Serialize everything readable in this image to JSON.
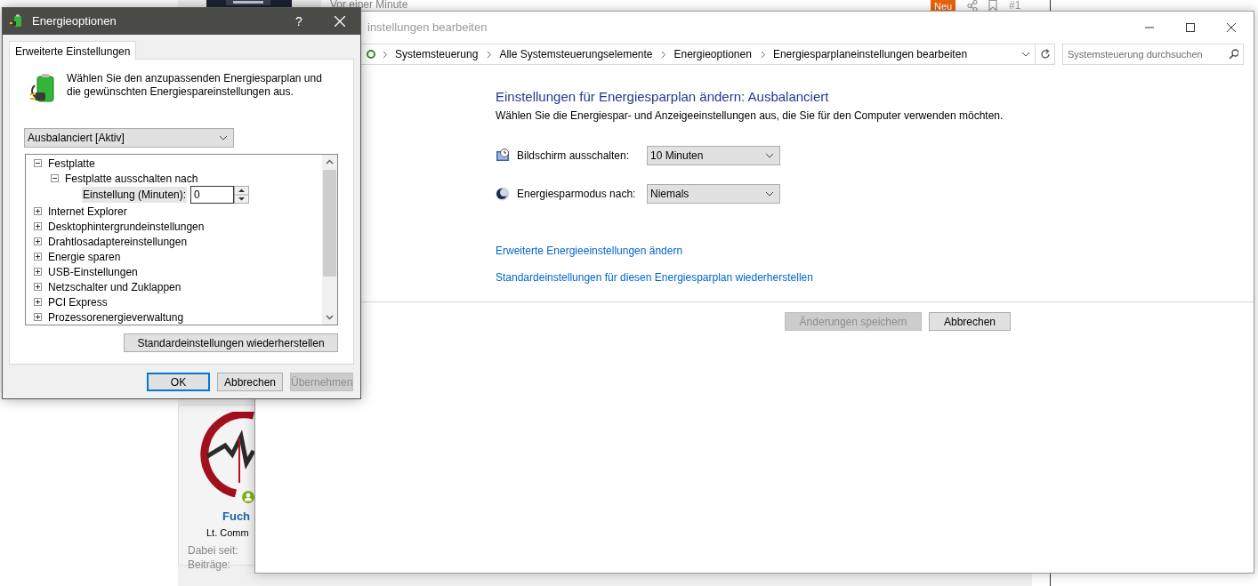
{
  "background_page": {
    "timestamp": "Vor einer Minute",
    "badge": "Neu",
    "post_number": "#1",
    "author": {
      "name": "Fuch",
      "rank": "Lt. Comm",
      "online": true,
      "fields": [
        "Dabei seit:",
        "Beiträge:"
      ]
    }
  },
  "control_panel": {
    "title": "instellungen bearbeiten",
    "breadcrumb": [
      "Systemsteuerung",
      "Alle Systemsteuerungselemente",
      "Energieoptionen",
      "Energiesparplaneinstellungen bearbeiten"
    ],
    "search": {
      "placeholder": "Systemsteuerung durchsuchen"
    },
    "heading": "Einstellungen für Energiesparplan ändern: Ausbalanciert",
    "subtitle": "Wählen Sie die Energiespar- und Anzeigeeinstellungen aus, die Sie für den Computer verwenden möchten.",
    "settings": [
      {
        "kind": "display",
        "label": "Bildschirm ausschalten:",
        "value": "10 Minuten"
      },
      {
        "kind": "sleep",
        "label": "Energiesparmodus nach:",
        "value": "Niemals"
      }
    ],
    "links": [
      "Erweiterte Energieeinstellungen ändern",
      "Standardeinstellungen für diesen Energiesparplan wiederherstellen"
    ],
    "buttons": [
      {
        "label": "Änderungen speichern",
        "disabled": true
      },
      {
        "label": "Abbrechen",
        "disabled": false
      }
    ]
  },
  "dialog": {
    "title": "Energieoptionen",
    "help_button": "?",
    "tabs": [
      {
        "label": "Erweiterte Einstellungen",
        "selected": true
      }
    ],
    "description": "Wählen Sie den anzupassenden Energiesparplan und die gewünschten Energiespareinstellungen aus.",
    "plan": "Ausbalanciert [Aktiv]",
    "tree": [
      {
        "kind": "node",
        "label": "Festplatte",
        "expanded": true,
        "children": [
          {
            "kind": "node",
            "label": "Festplatte ausschalten nach",
            "expanded": true,
            "children": [
              {
                "kind": "spin",
                "label": "Einstellung (Minuten):",
                "value": "0"
              }
            ]
          }
        ]
      },
      {
        "kind": "node",
        "label": "Internet Explorer",
        "expanded": false
      },
      {
        "kind": "node",
        "label": "Desktophintergrundeinstellungen",
        "expanded": false
      },
      {
        "kind": "node",
        "label": "Drahtlosadaptereinstellungen",
        "expanded": false
      },
      {
        "kind": "node",
        "label": "Energie sparen",
        "expanded": false
      },
      {
        "kind": "node",
        "label": "USB-Einstellungen",
        "expanded": false
      },
      {
        "kind": "node",
        "label": "Netzschalter und Zuklappen",
        "expanded": false
      },
      {
        "kind": "node",
        "label": "PCI Express",
        "expanded": false
      },
      {
        "kind": "node",
        "label": "Prozessorenergieverwaltung",
        "expanded": false
      }
    ],
    "restore_button": "Standardeinstellungen wiederherstellen",
    "buttons": [
      {
        "label": "OK",
        "default": true,
        "disabled": false
      },
      {
        "label": "Abbrechen",
        "default": false,
        "disabled": false
      },
      {
        "label": "Übernehmen",
        "default": false,
        "disabled": true
      }
    ]
  }
}
